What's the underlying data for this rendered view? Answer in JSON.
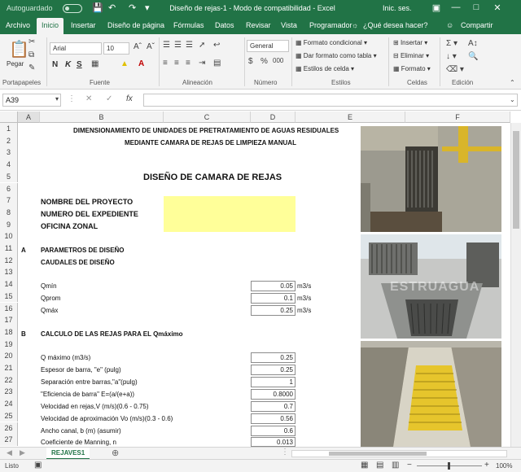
{
  "titlebar": {
    "autosave": "Autoguardado",
    "title": "Diseño de rejas-1  -  Modo de compatibilidad  -  Excel",
    "signin": "Inic. ses."
  },
  "tabs": [
    "Archivo",
    "Inicio",
    "Insertar",
    "Diseño de página",
    "Fórmulas",
    "Datos",
    "Revisar",
    "Vista",
    "Programador"
  ],
  "tell_me": "¿Qué desea hacer?",
  "share": "Compartir",
  "ribbon": {
    "paste": "Pegar",
    "clipboard": "Portapapeles",
    "font_name": "Arial",
    "font_size": "10",
    "font_group": "Fuente",
    "alignment_group": "Alineación",
    "number_format": "General",
    "number_group": "Número",
    "cond_format": "Formato condicional",
    "table_format": "Dar formato como tabla",
    "cell_styles": "Estilos de celda",
    "styles_group": "Estilos",
    "insert": "Insertar",
    "delete": "Eliminar",
    "format": "Formato",
    "cells_group": "Celdas",
    "editing_group": "Edición",
    "bold": "N",
    "italic": "K",
    "underline": "S"
  },
  "formula_bar": {
    "name_box": "A39",
    "fx": "fx"
  },
  "columns": [
    "A",
    "B",
    "C",
    "D",
    "E",
    "F"
  ],
  "rows": [
    1,
    2,
    3,
    4,
    5,
    6,
    7,
    8,
    9,
    10,
    11,
    12,
    13,
    14,
    15,
    16,
    17,
    18,
    19,
    20,
    21,
    22,
    23,
    24,
    25,
    26,
    27
  ],
  "sheet": {
    "title1": "DIMENSIONAMIENTO DE UNIDADES DE PRETRATAMIENTO DE AGUAS RESIDUALES",
    "title2": "MEDIANTE CAMARA DE REJAS DE LIMPIEZA MANUAL",
    "main_title": "DISEÑO DE CAMARA DE REJAS",
    "project": "NOMBRE DEL PROYECTO",
    "file_number": "NUMERO DEL EXPEDIENTE",
    "office": "OFICINA ZONAL",
    "sec_a": "A",
    "sec_a_title": "PARAMETROS DE DISEÑO",
    "sec_a_sub": "CAUDALES DE DISEÑO",
    "flows": [
      {
        "label": "Qmín",
        "value": "0.05",
        "unit": "m3/s"
      },
      {
        "label": "Qprom",
        "value": "0.1",
        "unit": "m3/s"
      },
      {
        "label": "Qmáx",
        "value": "0.25",
        "unit": "m3/s"
      }
    ],
    "sec_b": "B",
    "sec_b_title": "CALCULO DE LAS REJAS PARA EL Qmáximo",
    "calc": [
      {
        "label": "Q máximo (m3/s)",
        "value": "0.25"
      },
      {
        "label": "Espesor de barra, \"e\" (pulg)",
        "value": "0.25"
      },
      {
        "label": "Separación entre barras,\"a\"(pulg)",
        "value": "1"
      },
      {
        "label": "\"Eficiencia de barra\" E=(a/(e+a))",
        "value": "0.8000"
      },
      {
        "label": "Velocidad en rejas,V (m/s)(0.6 - 0.75)",
        "value": "0.7"
      },
      {
        "label": "Velocidad de aproximación Vo (m/s)(0.3 - 0.6)",
        "value": "0.56"
      },
      {
        "label": "Ancho canal, b (m)  (asumir)",
        "value": "0.6"
      },
      {
        "label": "Coeficiente de Manning, n",
        "value": "0.013"
      }
    ]
  },
  "watermark": "ESTRUAGUA",
  "sheet_tab": "REJAVES1",
  "status": {
    "ready": "Listo",
    "zoom": "100%"
  }
}
